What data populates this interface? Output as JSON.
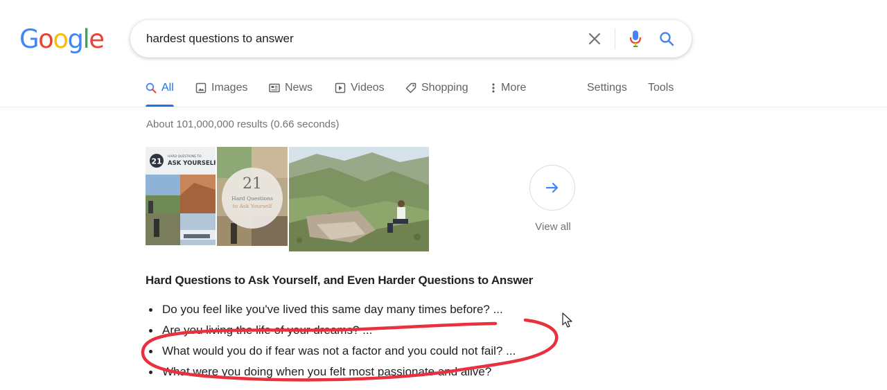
{
  "logo": {
    "letters": [
      "G",
      "o",
      "o",
      "g",
      "l",
      "e"
    ],
    "colors": [
      "#4285F4",
      "#EA4335",
      "#FBBC05",
      "#4285F4",
      "#34A853",
      "#EA4335"
    ]
  },
  "search": {
    "query": "hardest questions to answer",
    "clear_icon": "close-icon",
    "mic_icon": "mic-icon",
    "search_icon": "search-icon"
  },
  "tabs": [
    {
      "label": "All",
      "icon": "search-icon",
      "active": true
    },
    {
      "label": "Images",
      "icon": "image-icon",
      "active": false
    },
    {
      "label": "News",
      "icon": "news-icon",
      "active": false
    },
    {
      "label": "Videos",
      "icon": "video-icon",
      "active": false
    },
    {
      "label": "Shopping",
      "icon": "tag-icon",
      "active": false
    },
    {
      "label": "More",
      "icon": "more-vert-icon",
      "active": false
    },
    {
      "label": "Settings",
      "active": false
    },
    {
      "label": "Tools",
      "active": false
    }
  ],
  "results_stats": "About 101,000,000 results (0.66 seconds)",
  "image_strip": {
    "thumb1": {
      "number": "21",
      "caption_top": "HARD QUESTIONS TO",
      "caption_main": "ASK YOURSELF"
    },
    "thumb2": {
      "number": "21",
      "line1": "Hard Questions",
      "line2": "to Ask Yourself"
    },
    "view_all_label": "View all"
  },
  "snippet": {
    "title": "Hard Questions to Ask Yourself, and Even Harder Questions to Answer",
    "items": [
      "Do you feel like you've lived this same day many times before? ...",
      "Are you living the life of your dreams? ...",
      "What would you do if fear was not a factor and you could not fail? ...",
      "What were you doing when you felt most passionate and alive?"
    ]
  },
  "colors": {
    "accent": "#1a73e8",
    "annotation": "#e8303f"
  }
}
